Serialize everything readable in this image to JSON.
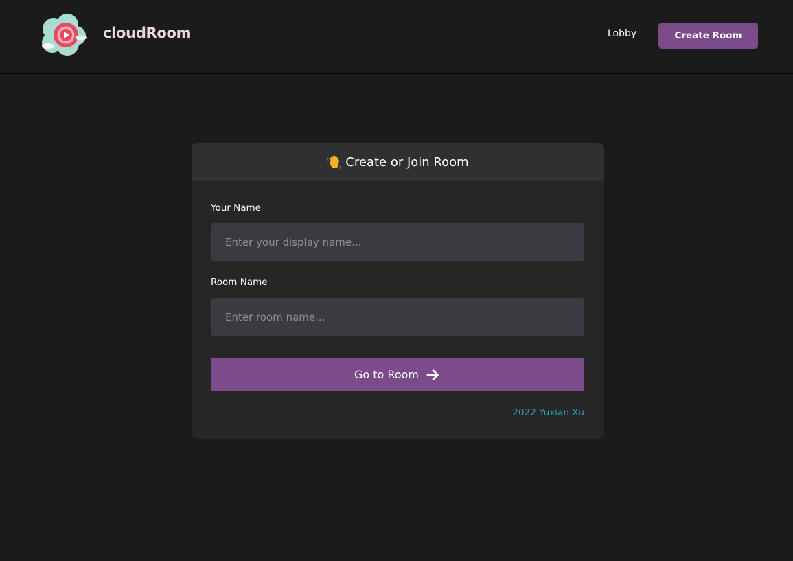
{
  "header": {
    "brand": "cloudRoom",
    "logo_icon": "cloud-play-logo-icon",
    "nav": {
      "lobby_label": "Lobby",
      "create_room_label": "Create Room"
    }
  },
  "card": {
    "title_icon": "waving-hand-icon",
    "title": "Create or Join Room",
    "name_field": {
      "label": "Your Name",
      "value": "",
      "placeholder": "Enter your display name..."
    },
    "room_field": {
      "label": "Room Name",
      "value": "",
      "placeholder": "Enter room name..."
    },
    "submit_label": "Go to Room",
    "submit_icon": "arrow-right-icon",
    "credit": "2022 Yuxian Xu"
  },
  "colors": {
    "background": "#1b1b1b",
    "card": "#262626",
    "card_header": "#303030",
    "accent": "#7b4b8a",
    "input": "#393b40",
    "credit_link": "#2aa3b8",
    "brand_text": "#ead7d7"
  }
}
